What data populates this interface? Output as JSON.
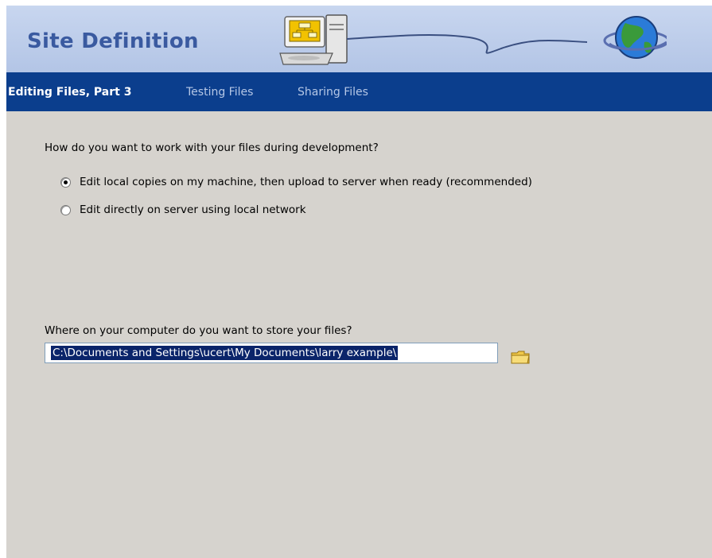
{
  "header": {
    "title": "Site Definition"
  },
  "tabs": [
    {
      "label": "Editing Files, Part 3",
      "active": true
    },
    {
      "label": "Testing Files",
      "active": false
    },
    {
      "label": "Sharing Files",
      "active": false
    }
  ],
  "editing": {
    "question": "How do you want to work with your files during development?",
    "options": [
      {
        "label": "Edit local copies on my machine, then upload to server when ready (recommended)",
        "selected": true
      },
      {
        "label": "Edit directly on server using local network",
        "selected": false
      }
    ]
  },
  "storage": {
    "label": "Where on your computer do you want to store your files?",
    "path_value": "C:\\Documents and Settings\\ucert\\My Documents\\larry example\\",
    "browse_icon": "folder-icon"
  },
  "colors": {
    "nav_background": "#0b3e8d",
    "header_background": "#c8d6ef",
    "title_color": "#3a5aa0",
    "panel_background": "#d6d3ce"
  }
}
